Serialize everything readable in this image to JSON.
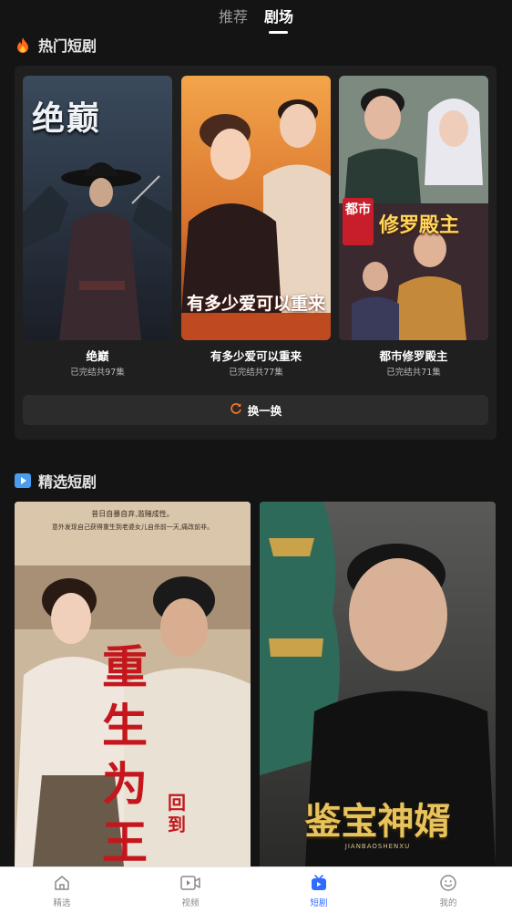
{
  "top_tabs": {
    "recommend": "推荐",
    "theater": "剧场",
    "active": "剧场"
  },
  "hot": {
    "title": "热门短剧",
    "cards": [
      {
        "title": "绝巅",
        "status": "已完结共97集",
        "poster_text": "绝巅"
      },
      {
        "title": "有多少爱可以重来",
        "status": "已完结共77集",
        "poster_text": "有多少爱可以重来"
      },
      {
        "title": "都市修罗殿主",
        "status": "已完结共71集",
        "poster_text_badge": "都市",
        "poster_text": "修罗殿主"
      }
    ],
    "refresh_label": "换一换"
  },
  "featured": {
    "title": "精选短剧",
    "items": [
      {
        "poster_headline": "重生为王",
        "poster_sub": "回到",
        "poster_top_line1": "昔日自暴自弃,滥赌成性。",
        "poster_top_line2": "意外发现自己获得重生到老婆女儿自杀前一天,痛改前非。"
      },
      {
        "poster_headline": "鉴宝神婿",
        "poster_sub": "JIANBAOSHENXU"
      }
    ]
  },
  "bottom_nav": {
    "items": [
      {
        "label": "精选",
        "icon": "home-icon",
        "active": false
      },
      {
        "label": "视频",
        "icon": "video-icon",
        "active": false
      },
      {
        "label": "短剧",
        "icon": "tv-icon",
        "active": true
      },
      {
        "label": "我的",
        "icon": "smile-icon",
        "active": false
      }
    ]
  },
  "colors": {
    "accent": "#2f6bff",
    "background": "#141414",
    "panel": "#1f1f1f",
    "fire": "#ff6a1a"
  }
}
